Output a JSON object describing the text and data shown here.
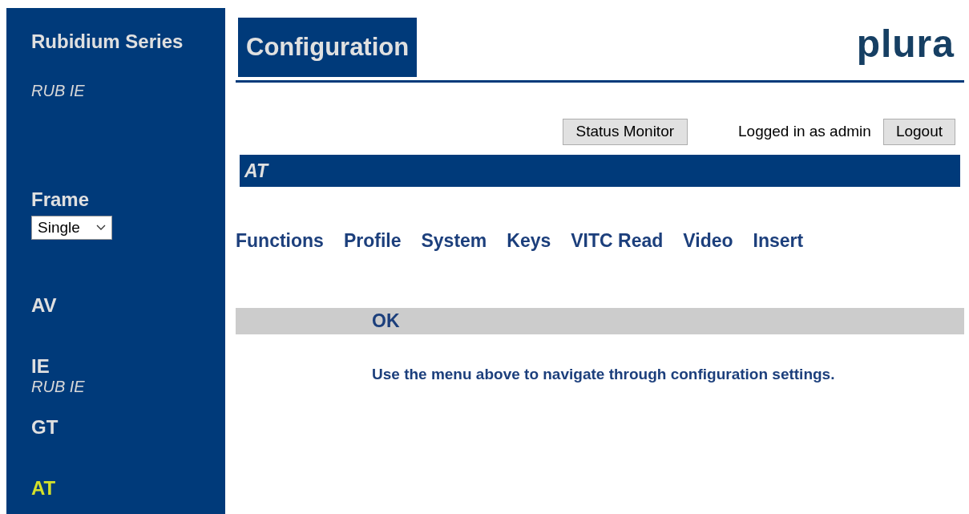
{
  "sidebar": {
    "series": "Rubidium Series",
    "model": "RUB IE",
    "frame": {
      "label": "Frame",
      "value": "Single"
    },
    "items": [
      {
        "label": "AV",
        "selected": false
      },
      {
        "label": "IE",
        "subtitle": "RUB IE",
        "selected": false
      },
      {
        "label": "GT",
        "selected": false
      },
      {
        "label": "AT",
        "selected": true
      }
    ]
  },
  "header": {
    "title": "Configuration",
    "logo": "plura"
  },
  "toolbar": {
    "status_button": "Status Monitor",
    "login_text": "Logged in as admin",
    "logout_button": "Logout"
  },
  "section_title": "AT",
  "menu": [
    "Functions",
    "Profile",
    "System",
    "Keys",
    "VITC Read",
    "Video",
    "Insert"
  ],
  "status": {
    "text": "OK",
    "message": "Use the menu above to navigate through configuration settings."
  }
}
